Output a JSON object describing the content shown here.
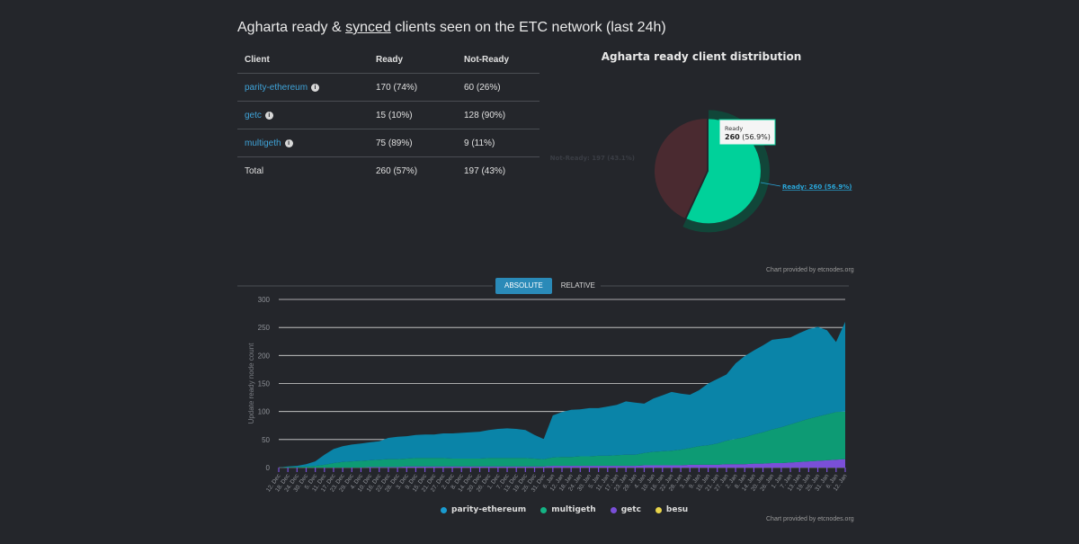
{
  "heading": {
    "before": "Agharta ready & ",
    "underlined": "synced",
    "after": " clients seen on the ETC network (last 24h)"
  },
  "table": {
    "headers": [
      "Client",
      "Ready",
      "Not-Ready"
    ],
    "rows": [
      {
        "client": "parity-ethereum",
        "ready": "170 (74%)",
        "not_ready": "60 (26%)"
      },
      {
        "client": "getc",
        "ready": "15 (10%)",
        "not_ready": "128 (90%)"
      },
      {
        "client": "multigeth",
        "ready": "75 (89%)",
        "not_ready": "9 (11%)"
      },
      {
        "client": "Total",
        "ready": "260 (57%)",
        "not_ready": "197 (43%)"
      }
    ]
  },
  "credit": "Chart provided by etcnodes.org",
  "tabs": {
    "absolute": "ABSOLUTE",
    "relative": "RELATIVE"
  },
  "colors": {
    "background": "#24262b",
    "ready": "#00d19a",
    "not_ready": "#4a2a30",
    "parity": "#0a84a8",
    "multigeth": "#0d9b74",
    "getc": "#7a4fd8",
    "besu": "#e8d44a"
  },
  "chart_data": [
    {
      "type": "pie",
      "title": "Agharta ready client distribution",
      "slices": [
        {
          "name": "Ready",
          "value": 260,
          "percent": 56.9,
          "label": "Ready: 260 (56.9%)"
        },
        {
          "name": "Not-Ready",
          "value": 197,
          "percent": 43.1,
          "label": "Not-Ready: 197 (43.1%)"
        }
      ],
      "tooltip": {
        "name": "Ready",
        "text": "260 (56.9%)"
      }
    },
    {
      "type": "area",
      "stacked": true,
      "ylabel": "Update ready node count",
      "ylim": [
        0,
        300
      ],
      "yticks": [
        0,
        50,
        100,
        150,
        200,
        250,
        300
      ],
      "grid": true,
      "legend_position": "bottom",
      "x_labels": [
        "12. Dec",
        "18. Dec",
        "24. Dec",
        "30. Dec",
        "5. Dec",
        "11. Dec",
        "17. Dec",
        "23. Dec",
        "29. Dec",
        "4. Dec",
        "10. Dec",
        "16. Dec",
        "22. Dec",
        "28. Dec",
        "3. Dec",
        "9. Dec",
        "15. Dec",
        "21. Dec",
        "27. Dec",
        "2. Dec",
        "8. Dec",
        "14. Dec",
        "20. Dec",
        "26. Dec",
        "1. Dec",
        "7. Dec",
        "13. Dec",
        "19. Dec",
        "25. Dec",
        "31. Dec",
        "6. Jan",
        "12. Jan",
        "18. Jan",
        "24. Jan",
        "30. Jan",
        "5. Jan",
        "11. Jan",
        "17. Jan",
        "23. Jan",
        "29. Jan",
        "4. Jan",
        "10. Jan",
        "16. Jan",
        "22. Jan",
        "28. Jan",
        "3. Jan",
        "9. Jan",
        "15. Jan",
        "21. Jan",
        "27. Jan",
        "2. Jan",
        "8. Jan",
        "14. Jan",
        "20. Jan",
        "26. Jan",
        "1. Jan",
        "7. Jan",
        "13. Jan",
        "19. Jan",
        "25. Jan",
        "31. Jan",
        "6. Jan",
        "12. Jan"
      ],
      "series": [
        {
          "name": "getc",
          "values": [
            0,
            0,
            0,
            0,
            0,
            0,
            0,
            0,
            0,
            0,
            1,
            1,
            1,
            1,
            2,
            2,
            2,
            2,
            2,
            2,
            2,
            2,
            2,
            2,
            2,
            2,
            2,
            2,
            2,
            2,
            3,
            3,
            3,
            3,
            3,
            3,
            3,
            3,
            3,
            3,
            4,
            4,
            4,
            4,
            4,
            5,
            5,
            5,
            5,
            6,
            6,
            6,
            7,
            7,
            8,
            8,
            9,
            10,
            11,
            12,
            13,
            14,
            15
          ]
        },
        {
          "name": "multigeth",
          "values": [
            0,
            1,
            1,
            2,
            3,
            5,
            8,
            10,
            11,
            12,
            12,
            13,
            14,
            14,
            14,
            15,
            15,
            15,
            15,
            14,
            14,
            14,
            14,
            15,
            15,
            15,
            15,
            15,
            14,
            13,
            15,
            16,
            16,
            17,
            17,
            18,
            18,
            19,
            20,
            20,
            22,
            24,
            25,
            26,
            28,
            30,
            33,
            35,
            38,
            42,
            45,
            48,
            52,
            56,
            60,
            64,
            68,
            72,
            76,
            79,
            82,
            85,
            85
          ]
        },
        {
          "name": "parity-ethereum",
          "values": [
            0,
            1,
            2,
            4,
            8,
            18,
            25,
            28,
            30,
            31,
            32,
            33,
            38,
            40,
            40,
            41,
            42,
            42,
            44,
            45,
            46,
            47,
            48,
            50,
            52,
            53,
            52,
            50,
            42,
            36,
            75,
            80,
            84,
            84,
            86,
            85,
            88,
            90,
            95,
            93,
            88,
            95,
            100,
            105,
            100,
            95,
            100,
            110,
            115,
            118,
            135,
            145,
            150,
            155,
            160,
            158,
            155,
            158,
            160,
            160,
            150,
            125,
            160
          ]
        },
        {
          "name": "besu",
          "values": [
            0,
            0,
            0,
            0,
            0,
            0,
            0,
            0,
            0,
            0,
            0,
            0,
            0,
            0,
            0,
            0,
            0,
            0,
            0,
            0,
            0,
            0,
            0,
            0,
            0,
            0,
            0,
            0,
            0,
            0,
            0,
            0,
            0,
            0,
            0,
            0,
            0,
            0,
            0,
            0,
            0,
            0,
            0,
            0,
            0,
            0,
            0,
            0,
            0,
            0,
            0,
            0,
            0,
            0,
            0,
            0,
            0,
            0,
            0,
            0,
            0,
            0,
            0
          ]
        }
      ]
    }
  ]
}
